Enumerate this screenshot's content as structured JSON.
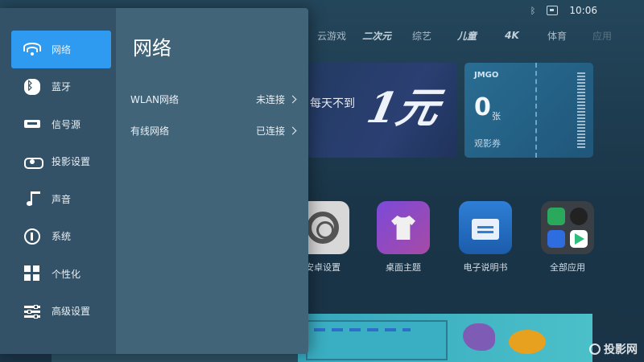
{
  "status_bar": {
    "time": "10:06"
  },
  "top_nav": {
    "items": [
      {
        "label": "云游戏"
      },
      {
        "label": "二次元"
      },
      {
        "label": "综艺"
      },
      {
        "label": "儿童"
      },
      {
        "label": "4K"
      },
      {
        "label": "体育"
      },
      {
        "label": "应用"
      }
    ]
  },
  "banner": {
    "text": "每天不到",
    "big_text": "1元"
  },
  "ticket": {
    "brand": "JMGO",
    "count": "0",
    "unit": "张",
    "label": "观影券"
  },
  "apps": [
    {
      "label": "安卓设置",
      "icon": "settings-gear-icon"
    },
    {
      "label": "桌面主题",
      "icon": "theme-shirt-icon"
    },
    {
      "label": "电子说明书",
      "icon": "manual-icon"
    },
    {
      "label": "全部应用",
      "icon": "all-apps-icon"
    }
  ],
  "settings": {
    "sidebar": [
      {
        "label": "网络",
        "icon": "wifi-icon",
        "active": true
      },
      {
        "label": "蓝牙",
        "icon": "bluetooth-icon"
      },
      {
        "label": "信号源",
        "icon": "signal-source-icon"
      },
      {
        "label": "投影设置",
        "icon": "projector-icon"
      },
      {
        "label": "声音",
        "icon": "music-note-icon"
      },
      {
        "label": "系统",
        "icon": "info-icon"
      },
      {
        "label": "个性化",
        "icon": "grid-icon"
      },
      {
        "label": "高级设置",
        "icon": "sliders-icon"
      }
    ],
    "detail": {
      "title": "网络",
      "rows": [
        {
          "label": "WLAN网络",
          "value": "未连接"
        },
        {
          "label": "有线网络",
          "value": "已连接"
        }
      ]
    }
  },
  "watermark": "投影网",
  "colors": {
    "accent": "#2e9bf1",
    "sidebar_bg": "#335267",
    "detail_bg": "#426479"
  }
}
